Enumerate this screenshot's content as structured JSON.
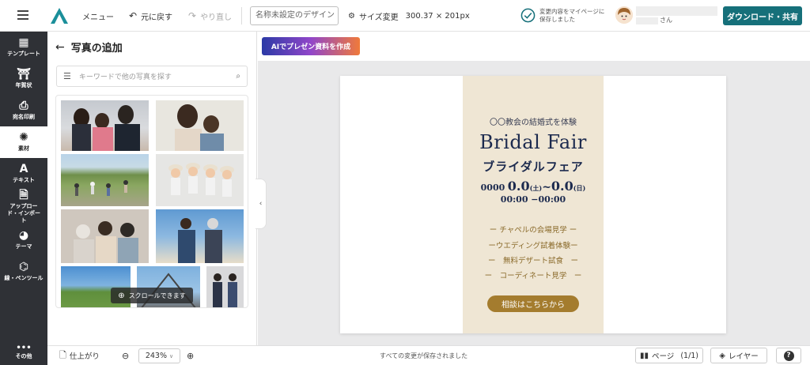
{
  "topbar": {
    "menu_label": "メニュー",
    "undo_label": "元に戻す",
    "redo_label": "やり直し",
    "design_name_placeholder": "名称未設定のデザイン",
    "resize_label": "サイズ変更",
    "size_value": "300.37 × 201px",
    "save_status_line1": "変更内容をマイページに",
    "save_status_line2": "保存しました",
    "user_suffix": "さん",
    "download_label": "ダウンロード・共有",
    "accent_color": "#16707a"
  },
  "sidebar": {
    "items": [
      {
        "label": "テンプレート",
        "icon": "template-icon"
      },
      {
        "label": "年賀状",
        "icon": "newyear-card-icon"
      },
      {
        "label": "宛名印刷",
        "icon": "printer-icon"
      },
      {
        "label": "素材",
        "icon": "elements-icon"
      },
      {
        "label": "テキスト",
        "icon": "text-icon"
      },
      {
        "label": "アップロード・インポート",
        "icon": "upload-icon"
      },
      {
        "label": "テーマ",
        "icon": "palette-icon"
      },
      {
        "label": "線・ペンツール",
        "icon": "pen-tool-icon"
      }
    ],
    "more_label": "その他"
  },
  "panel": {
    "title": "写真の追加",
    "search_placeholder": "キーワードで他の写真を探す",
    "scroll_hint": "スクロールできます"
  },
  "ai_button_label": "AIでプレゼン資料を作成",
  "design": {
    "subtitle": "〇〇教会の結婚式を体験",
    "title_en": "Bridal Fair",
    "title_ja": "ブライダルフェア",
    "date_prefix": "0000",
    "date_start": "0.0",
    "date_start_day": "(土)",
    "date_tilde": "~",
    "date_end": "0.0",
    "date_end_day": "(日)",
    "time": "00:00 −00:00",
    "features": [
      "ー チャペルの会場見学 ー",
      "ーウエディング試着体験ー",
      "ー　無料デザート試食　ー",
      "ー　コーディネート見学　ー"
    ],
    "cta_label": "相談はこちらから",
    "band_color": "#efe6d4",
    "title_color": "#1c2a4e",
    "cta_color": "#a47c2e"
  },
  "bottombar": {
    "finish_label": "仕上がり",
    "zoom_value": "243%",
    "status_text": "すべての変更が保存されました",
    "page_label": "ページ",
    "page_count": "(1/1)",
    "layer_label": "レイヤー",
    "help_label": "?"
  }
}
